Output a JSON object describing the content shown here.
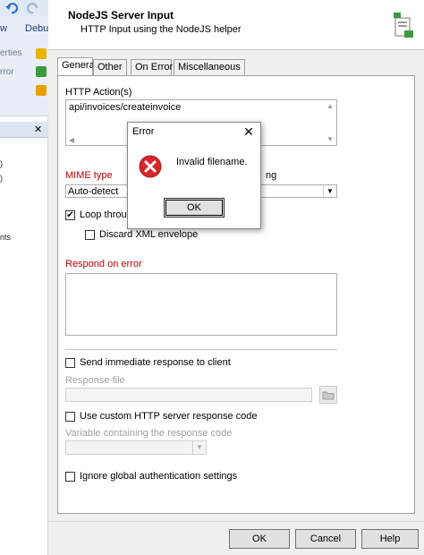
{
  "background_app": {
    "menu_tabs": [
      "w",
      "Debu"
    ],
    "ribbon_items": [
      "erties",
      "rror"
    ],
    "panel_close": "✕",
    "tree_fragments": [
      ")",
      ")",
      "nts"
    ]
  },
  "dialog": {
    "title": "NodeJS Server Input",
    "subtitle": "HTTP Input using the NodeJS helper",
    "tabs": [
      "General",
      "Other",
      "On Error",
      "Miscellaneous"
    ],
    "http_action_label": "HTTP Action(s)",
    "http_action_value": "api/invoices/createinvoice",
    "mime_type_label": "MIME type",
    "mime_type_value": "Auto-detect",
    "encoding_label_fragment": "ng",
    "loop_through_label": "Loop through",
    "loop_through_checked": true,
    "discard_xml_label": "Discard XML envelope",
    "discard_xml_checked": false,
    "respond_on_error_label": "Respond on error",
    "respond_on_error_value": "",
    "send_immediate_label": "Send immediate response to client",
    "send_immediate_checked": false,
    "response_file_label": "Response file",
    "response_file_value": "",
    "custom_code_label": "Use custom HTTP server response code",
    "custom_code_checked": false,
    "variable_code_label": "Variable containing the response code",
    "ignore_auth_label": "Ignore global authentication settings",
    "ignore_auth_checked": false,
    "buttons": {
      "ok": "OK",
      "cancel": "Cancel",
      "help": "Help"
    }
  },
  "error_popup": {
    "title": "Error",
    "message": "Invalid filename.",
    "ok_label": "OK",
    "close_glyph": "✕"
  },
  "colors": {
    "accent_red": "#c00000",
    "error_icon": "#d7262c",
    "disabled_text": "#a0a0a0"
  }
}
